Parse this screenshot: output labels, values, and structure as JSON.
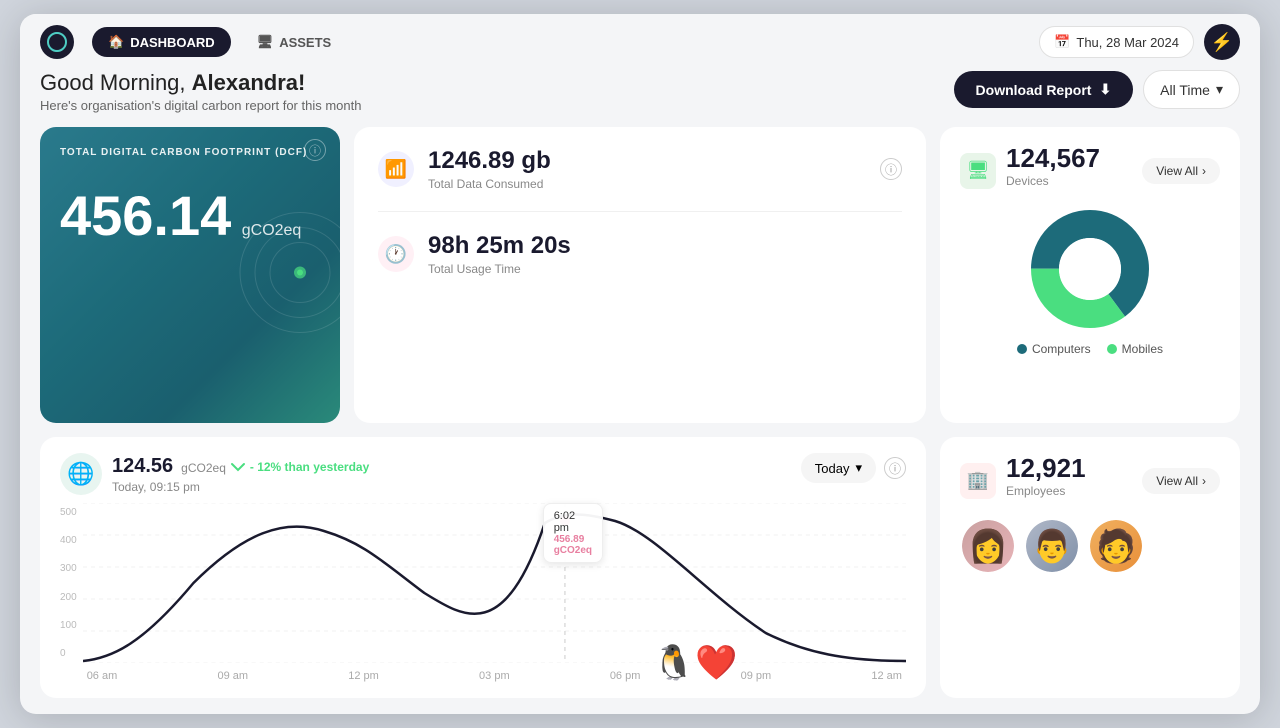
{
  "nav": {
    "dashboard_label": "DASHBOARD",
    "assets_label": "ASSETS",
    "date": "Thu, 28 Mar 2024"
  },
  "header": {
    "greeting": "Good Morning,",
    "name": "Alexandra!",
    "subtitle": "Here's organisation's digital carbon report for this month",
    "download_label": "Download Report",
    "alltime_label": "All Time"
  },
  "dcf": {
    "title": "TOTAL DIGITAL CARBON FOOTPRINT (DCF)",
    "value": "456.14",
    "unit": "gCO2eq"
  },
  "metrics": {
    "data_value": "1246.89 gb",
    "data_label": "Total Data Consumed",
    "time_value": "98h 25m 20s",
    "time_label": "Total Usage Time"
  },
  "devices": {
    "count": "124,567",
    "label": "Devices",
    "view_all": "View All",
    "computers_label": "Computers",
    "mobiles_label": "Mobiles",
    "computers_pct": 65,
    "mobiles_pct": 35
  },
  "employees": {
    "count": "12,921",
    "label": "Employees",
    "view_all": "View All"
  },
  "chart": {
    "value": "124.56",
    "unit": "gCO2eq",
    "trend": "- 12% than yesterday",
    "time": "Today, 09:15 pm",
    "today_label": "Today",
    "tooltip_time": "6:02 pm",
    "tooltip_val": "456.89 gCO2eq",
    "x_labels": [
      "06 am",
      "09 am",
      "12 pm",
      "03 pm",
      "06 pm",
      "09 pm",
      "12 am"
    ],
    "y_labels": [
      "500",
      "400",
      "300",
      "200",
      "100",
      "0"
    ]
  }
}
